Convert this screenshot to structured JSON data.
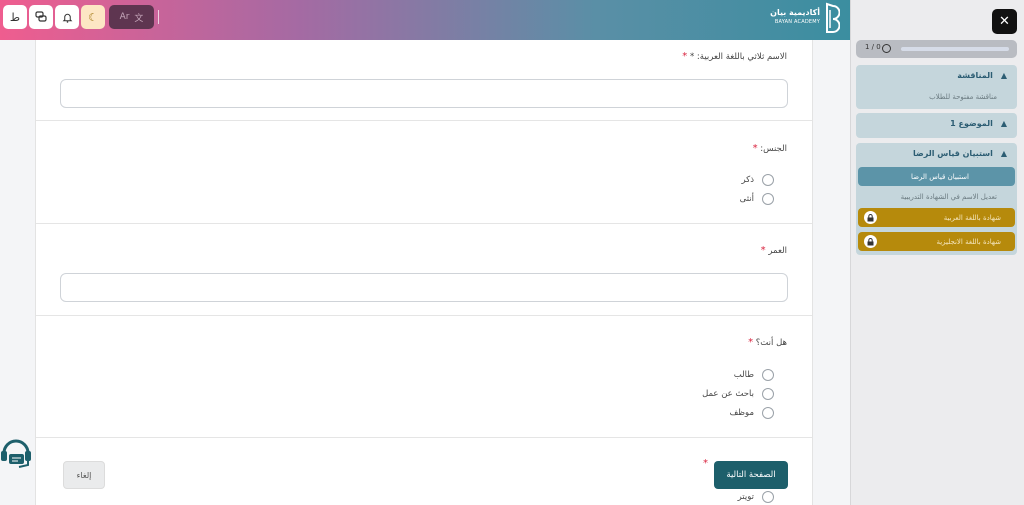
{
  "header": {
    "buttons": [
      {
        "name": "profile-button",
        "label": "ط"
      },
      {
        "name": "chat-button",
        "label": "💬"
      },
      {
        "name": "notifications-button",
        "label": "🔔"
      },
      {
        "name": "theme-button",
        "label": "☾"
      }
    ],
    "language": {
      "text": "Ar"
    },
    "logo": {
      "arabic": "أكاديمية بيان",
      "english": "BAYAN ACADEMY"
    }
  },
  "form": {
    "questions": [
      {
        "label": "الاسم ثلاثي باللغة العربية: *",
        "type": "text"
      },
      {
        "label": "الجنس:",
        "type": "radio",
        "options": [
          "ذكر",
          "أنثى"
        ]
      },
      {
        "label": "العمر",
        "type": "text"
      },
      {
        "label": "هل أنت؟",
        "type": "radio",
        "options": [
          "طالب",
          "باحث عن عمل",
          "موظف"
        ]
      },
      {
        "label": "",
        "type": "radio",
        "options": [
          "تويتر"
        ]
      }
    ],
    "next_button": "الصفحة التالية",
    "cancel_button": "إلغاء"
  },
  "sidebar": {
    "progress": {
      "text": "1 / 0"
    },
    "sections": [
      {
        "title": "المناقشة",
        "items": [
          "مناقشة مفتوحة للطلاب"
        ]
      },
      {
        "title": "الموضوع 1",
        "items": []
      },
      {
        "title": "استبيان قياس الرضا",
        "items": [
          "استبيان قياس الرضا",
          "تعديل الاسم في الشهادة التدريبية",
          "شهادة باللغة العربية",
          "شهادة باللغة الانجليزية"
        ]
      }
    ]
  },
  "colors": {
    "primary": "#1d5f6b",
    "required": "#d9233f",
    "locked": "#b68a0c",
    "active": "#5c94a8"
  }
}
